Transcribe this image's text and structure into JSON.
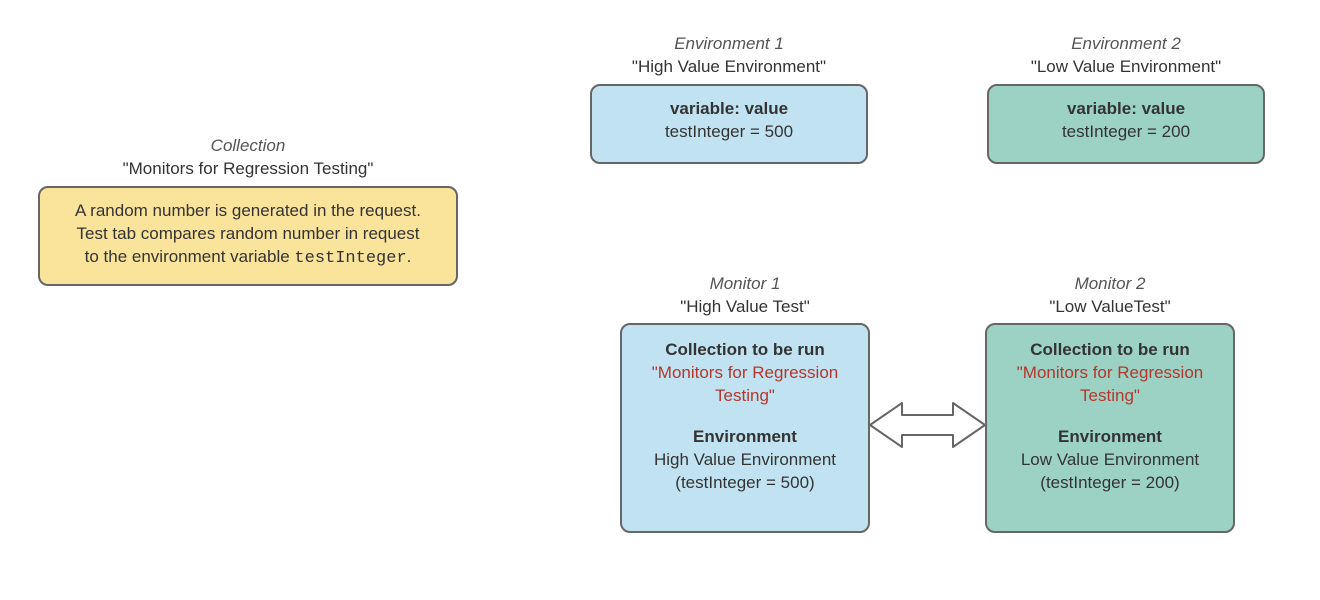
{
  "collection": {
    "label_italic": "Collection",
    "label_name": "\"Monitors for Regression Testing\"",
    "desc_line1": "A random number is generated in the request.",
    "desc_line2": "Test tab compares random number in request",
    "desc_line3_prefix": "to the environment variable ",
    "desc_line3_code": "testInteger",
    "desc_line3_suffix": "."
  },
  "env1": {
    "label_italic": "Environment 1",
    "label_name": "\"High Value Environment\"",
    "var_header": "variable: value",
    "var_line": "testInteger = 500"
  },
  "env2": {
    "label_italic": "Environment 2",
    "label_name": "\"Low Value Environment\"",
    "var_header": "variable: value",
    "var_line": "testInteger = 200"
  },
  "mon1": {
    "label_italic": "Monitor 1",
    "label_name": "\"High Value Test\"",
    "coll_header": "Collection to be run",
    "coll_name_l1": "\"Monitors for Regression",
    "coll_name_l2": "Testing\"",
    "env_header": "Environment",
    "env_name": "High Value Environment",
    "env_detail": "(testInteger = 500)"
  },
  "mon2": {
    "label_italic": "Monitor 2",
    "label_name": "\"Low ValueTest\"",
    "coll_header": "Collection to be run",
    "coll_name_l1": "\"Monitors for Regression",
    "coll_name_l2": "Testing\"",
    "env_header": "Environment",
    "env_name": "Low Value Environment",
    "env_detail": "(testInteger = 200)"
  }
}
